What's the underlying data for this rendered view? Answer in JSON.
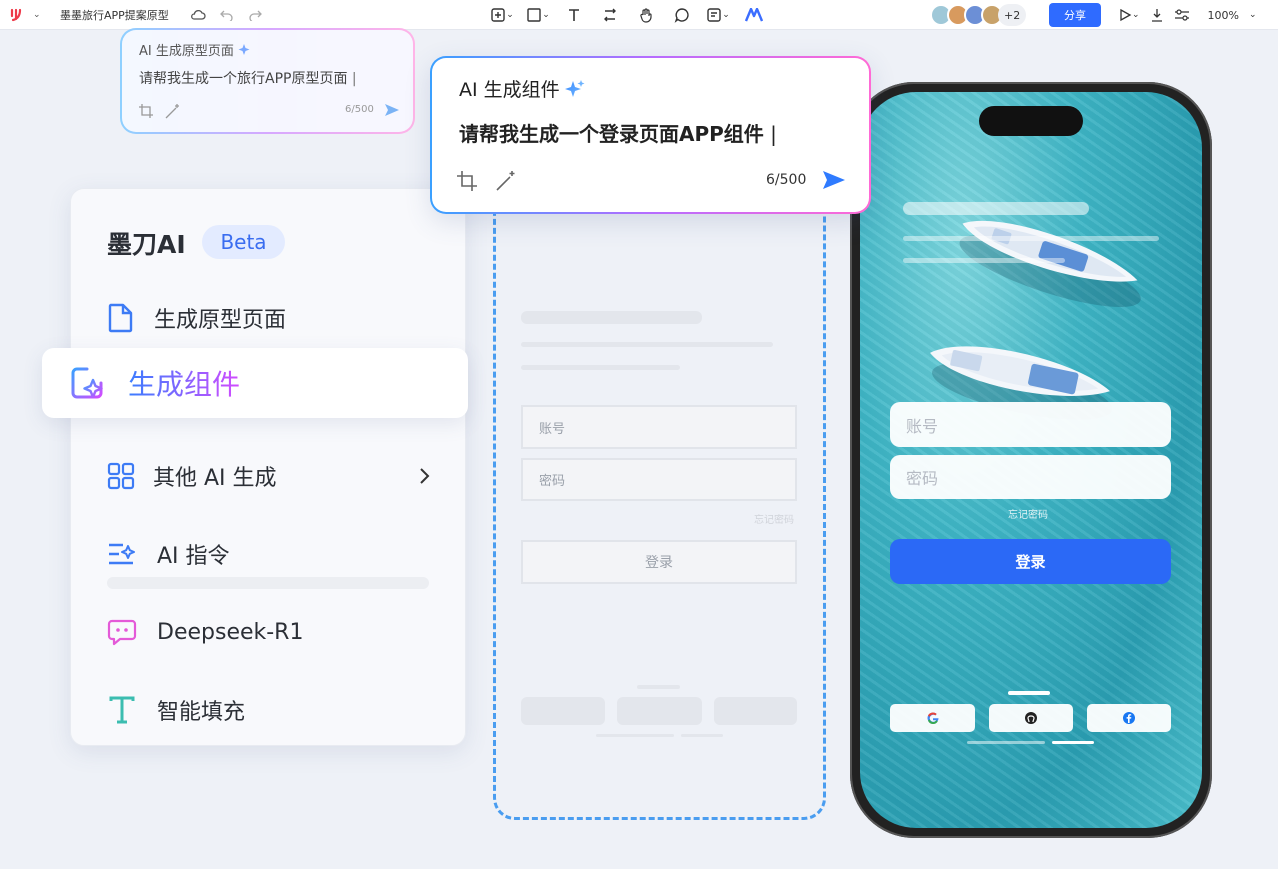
{
  "topbar": {
    "doc_title": "墨墨旅行APP提案原型",
    "avatar_more": "+2",
    "share_label": "分享",
    "zoom": "100%"
  },
  "prompt_small": {
    "title": "AI 生成原型页面",
    "text": "请帮我生成一个旅行APP原型页面",
    "counter": "6/500"
  },
  "prompt_large": {
    "title": "AI 生成组件",
    "text": "请帮我生成一个登录页面APP组件",
    "counter": "6/500"
  },
  "ai_panel": {
    "brand": "墨刀AI",
    "badge": "Beta",
    "items": [
      {
        "label": "生成原型页面",
        "icon": "document-icon"
      },
      {
        "label": "生成组件",
        "icon": "component-sparkle-icon",
        "active": true
      },
      {
        "label": "其他 AI 生成",
        "icon": "grid-icon"
      },
      {
        "label": "AI 指令",
        "icon": "instruction-icon"
      },
      {
        "label": "Deepseek-R1",
        "icon": "chat-bubble-icon"
      },
      {
        "label": "智能填充",
        "icon": "text-fill-icon"
      }
    ]
  },
  "wireframe": {
    "account": "账号",
    "password": "密码",
    "forgot": "忘记密码",
    "login": "登录"
  },
  "phone": {
    "account": "账号",
    "password": "密码",
    "forgot": "忘记密码",
    "login": "登录"
  },
  "colors": {
    "accent": "#2f6bff",
    "login_button": "#2b69f6",
    "active_gradient_start": "#3aa0ff",
    "active_gradient_end": "#d24bff"
  }
}
